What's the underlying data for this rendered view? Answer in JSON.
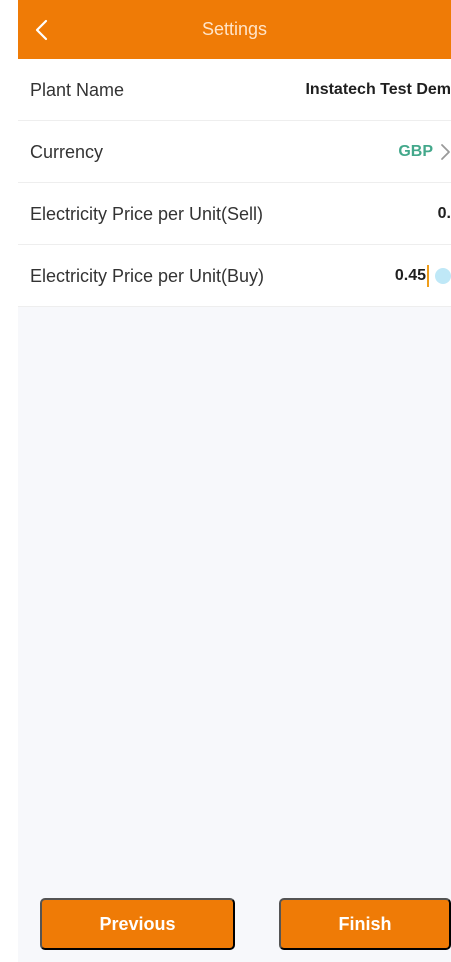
{
  "header": {
    "title": "Settings",
    "back_icon": "chevron-left-icon"
  },
  "settings": {
    "rows": [
      {
        "label": "Plant Name",
        "value": "Instatech Test Dem"
      },
      {
        "label": "Currency",
        "value": "GBP",
        "icon": "chevron-right-icon"
      },
      {
        "label": "Electricity Price per Unit(Sell)",
        "value": "0."
      },
      {
        "label": "Electricity Price per Unit(Buy)",
        "value": "0.45"
      }
    ]
  },
  "footer": {
    "previous_label": "Previous",
    "finish_label": "Finish"
  },
  "colors": {
    "primary": "#EF7B06",
    "currency_accent": "#43A88B",
    "background": "#F7F8FB"
  }
}
